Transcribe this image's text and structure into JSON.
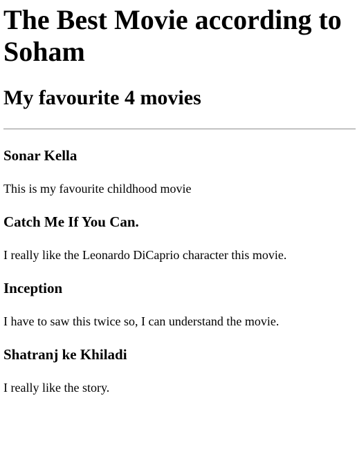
{
  "page": {
    "title": "The Best Movie according to Soham",
    "subtitle": "My favourite 4 movies"
  },
  "movies": [
    {
      "name": "Sonar Kella",
      "description": "This is my favourite childhood movie"
    },
    {
      "name": "Catch Me If You Can.",
      "description": "I really like the Leonardo DiCaprio character this movie."
    },
    {
      "name": "Inception",
      "description": "I have to saw this twice so, I can understand the movie."
    },
    {
      "name": "Shatranj ke Khiladi",
      "description": "I really like the story."
    }
  ]
}
